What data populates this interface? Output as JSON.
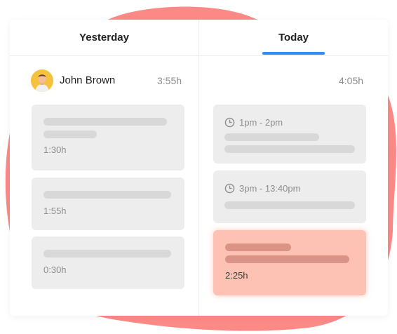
{
  "tabs": {
    "yesterday": "Yesterday",
    "today": "Today"
  },
  "user": {
    "name": "John Brown"
  },
  "totals": {
    "yesterday": "3:55h",
    "today": "4:05h"
  },
  "yesterday_cards": [
    {
      "time": "1:30h"
    },
    {
      "time": "1:55h"
    },
    {
      "time": "0:30h"
    }
  ],
  "today_cards": [
    {
      "slot": "1pm - 2pm"
    },
    {
      "slot": "3pm - 13:40pm"
    },
    {
      "time": "2:25h"
    }
  ],
  "colors": {
    "accent": "#2f8ff5",
    "blob": "#fb8a87",
    "highlight_card": "#fec2b4"
  },
  "icons": {
    "slot": "clock-icon"
  }
}
